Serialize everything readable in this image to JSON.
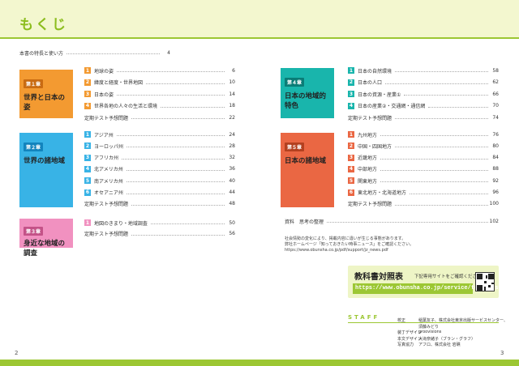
{
  "header": {
    "title": "もくじ"
  },
  "page_numbers": {
    "left": "2",
    "right": "3"
  },
  "intro": {
    "label": "本書の特長と使い方",
    "page": "4"
  },
  "chapters": [
    {
      "no": "第１章",
      "title_line1": "世界と日本の姿",
      "title_line2": "",
      "color": "#f39a31",
      "items": [
        {
          "num": "1",
          "label": "地球の姿",
          "page": "6"
        },
        {
          "num": "2",
          "label": "緯度と経度・世界地図",
          "page": "10"
        },
        {
          "num": "3",
          "label": "日本の姿",
          "page": "14"
        },
        {
          "num": "4",
          "label": "世界各地の人々の生活と環境",
          "page": "18"
        }
      ],
      "test": {
        "label": "定期テスト予想問題",
        "page": "22"
      }
    },
    {
      "no": "第２章",
      "title_line1": "世界の諸地域",
      "title_line2": "",
      "color": "#38b3e6",
      "items": [
        {
          "num": "1",
          "label": "アジア州",
          "page": "24"
        },
        {
          "num": "2",
          "label": "ヨーロッパ州",
          "page": "28"
        },
        {
          "num": "3",
          "label": "アフリカ州",
          "page": "32"
        },
        {
          "num": "4",
          "label": "北アメリカ州",
          "page": "36"
        },
        {
          "num": "5",
          "label": "南アメリカ州",
          "page": "40"
        },
        {
          "num": "6",
          "label": "オセアニア州",
          "page": "44"
        }
      ],
      "test": {
        "label": "定期テスト予想問題",
        "page": "48"
      }
    },
    {
      "no": "第３章",
      "title_line1": "身近な地域の調査",
      "title_line2": "",
      "color": "#f191c0",
      "items": [
        {
          "num": "1",
          "label": "地図のきまり・地域調査",
          "page": "50"
        }
      ],
      "test": {
        "label": "定期テスト予想問題",
        "page": "56"
      }
    },
    {
      "no": "第４章",
      "title_line1": "日本の地域的",
      "title_line2": "特色",
      "color": "#19b5ac",
      "items": [
        {
          "num": "1",
          "label": "日本の自然環境",
          "page": "58"
        },
        {
          "num": "2",
          "label": "日本の人口",
          "page": "62"
        },
        {
          "num": "3",
          "label": "日本の資源・産業①",
          "page": "66"
        },
        {
          "num": "4",
          "label": "日本の産業②・交通網・通信網",
          "page": "70"
        }
      ],
      "test": {
        "label": "定期テスト予想問題",
        "page": "74"
      }
    },
    {
      "no": "第５章",
      "title_line1": "日本の諸地域",
      "title_line2": "",
      "color": "#ea6743",
      "items": [
        {
          "num": "1",
          "label": "九州地方",
          "page": "76"
        },
        {
          "num": "2",
          "label": "中国・四国地方",
          "page": "80"
        },
        {
          "num": "3",
          "label": "近畿地方",
          "page": "84"
        },
        {
          "num": "4",
          "label": "中部地方",
          "page": "88"
        },
        {
          "num": "5",
          "label": "関東地方",
          "page": "92"
        },
        {
          "num": "6",
          "label": "東北地方・北海道地方",
          "page": "96"
        }
      ],
      "test": {
        "label": "定期テスト予想問題",
        "page": "100"
      }
    }
  ],
  "reference": {
    "label": "資料　思考の整理",
    "page": "102"
  },
  "notes": [
    "社会情勢の変化により、掲載内容に違いが生じる事態があります。",
    "弊社ホームページ「知っておきたい時事ニュース」をご確認ください。",
    "https://www.obunsha.co.jp/pdf/support/jz_news.pdf"
  ],
  "textbook": {
    "title": "教科書対照表",
    "subtitle": "下記専用サイトをご確認ください。",
    "url": "https://www.obunsha.co.jp/service/teikitest/"
  },
  "staff": {
    "title": "STAFF",
    "rows": [
      {
        "role": "校正",
        "name": "稲葉友子、株式会社東京出版サービスセンター、"
      },
      {
        "role": "",
        "name": "須藤みどり"
      },
      {
        "role": "装丁デザイン",
        "name": "groovisions"
      },
      {
        "role": "本文デザイン",
        "name": "大滝奈緒子（ブラン・グラフ）"
      },
      {
        "role": "写真協力",
        "name": "アフロ、株式会社 岩礁"
      }
    ]
  }
}
